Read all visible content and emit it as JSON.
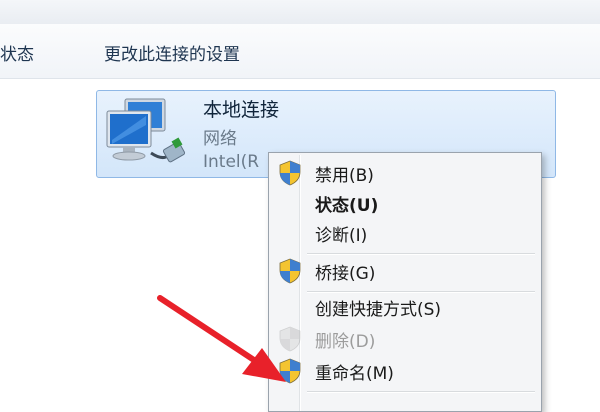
{
  "commandbar": {
    "status_label": "状态",
    "settings_label": "更改此连接的设置"
  },
  "connection": {
    "name": "本地连接",
    "type": "网络",
    "adapter": "Intel(R",
    "icon": "network-adapter-icon"
  },
  "context_menu": {
    "items": [
      {
        "label": "禁用(B)",
        "icon": "uac-shield-icon"
      },
      {
        "label": "状态(U)",
        "bold": true
      },
      {
        "label": "诊断(I)"
      },
      {
        "label": "桥接(G)",
        "icon": "uac-shield-icon"
      },
      {
        "label": "创建快捷方式(S)"
      },
      {
        "label": "删除(D)",
        "icon": "uac-shield-icon",
        "disabled": true
      },
      {
        "label": "重命名(M)",
        "icon": "uac-shield-icon"
      }
    ]
  },
  "annotation": {
    "arrow_color": "#e8212a"
  }
}
